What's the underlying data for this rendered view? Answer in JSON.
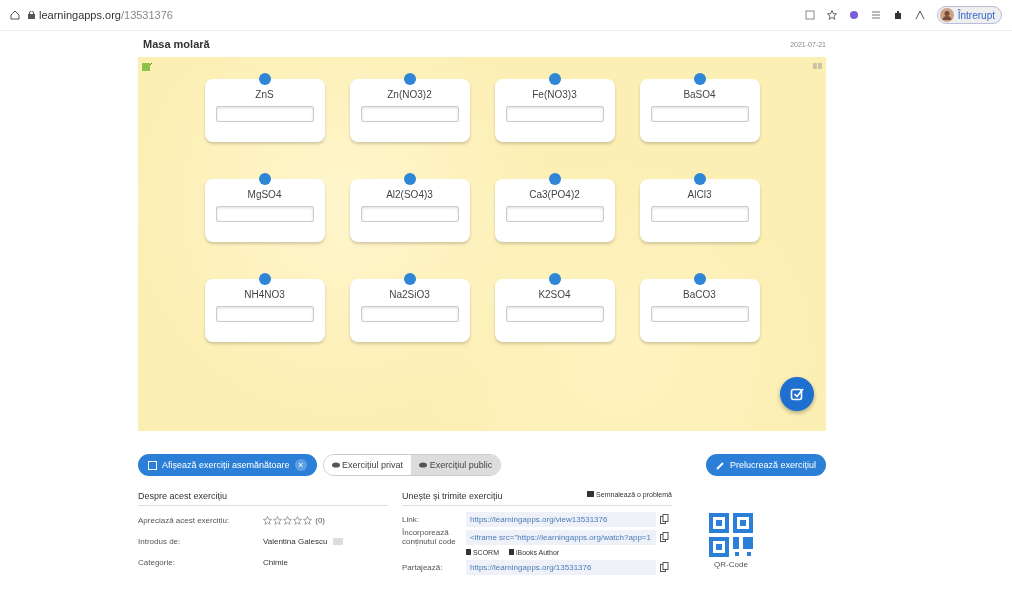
{
  "browser": {
    "url_host": "learningapps.org",
    "url_path": "/13531376",
    "profile_label": "Întrerupt"
  },
  "app": {
    "title": "Masa molară",
    "date": "2021-07-21",
    "cards": [
      {
        "label": "ZnS"
      },
      {
        "label": "Zn(NO3)2"
      },
      {
        "label": "Fe(NO3)3"
      },
      {
        "label": "BaSO4"
      },
      {
        "label": "MgSO4"
      },
      {
        "label": "Al2(SO4)3"
      },
      {
        "label": "Ca3(PO4)2"
      },
      {
        "label": "AlCl3"
      },
      {
        "label": "NH4NO3"
      },
      {
        "label": "Na2SiO3"
      },
      {
        "label": "K2SO4"
      },
      {
        "label": "BaCO3"
      }
    ]
  },
  "toolbar": {
    "similar_button": "Afișează exerciții asemănătoare",
    "similar_close": "×",
    "visibility": [
      {
        "label": "Exercițiul privat",
        "selected": false
      },
      {
        "label": "Exercițiul public",
        "selected": true
      }
    ],
    "edit_button": "Prelucrează exercițiul"
  },
  "about": {
    "heading": "Despre acest exercițiu",
    "rows": [
      {
        "kind": "rating",
        "label": "Apreciază acest exercițiu:",
        "stars": 0,
        "count": "(0)"
      },
      {
        "kind": "author",
        "label": "Introdus de:",
        "value": "Valentina Galescu"
      },
      {
        "kind": "text",
        "label": "Categorie:",
        "value": "Chimie"
      }
    ]
  },
  "share": {
    "heading": "Unește și trimite exercițiu",
    "report": "Semnalează o problemă",
    "rows": [
      {
        "label": "Link:",
        "value": "https://learningapps.org/view13531376"
      },
      {
        "label": "Încorporează conținutul code",
        "value": "<iframe src=\"https://learningapps.org/watch?app=1"
      },
      {
        "label": "Partajează:",
        "value": "https://learningapps.org/13531376"
      }
    ],
    "exports": [
      "SCORM",
      "iBooks Author"
    ],
    "qr_caption": "QR-Code"
  }
}
